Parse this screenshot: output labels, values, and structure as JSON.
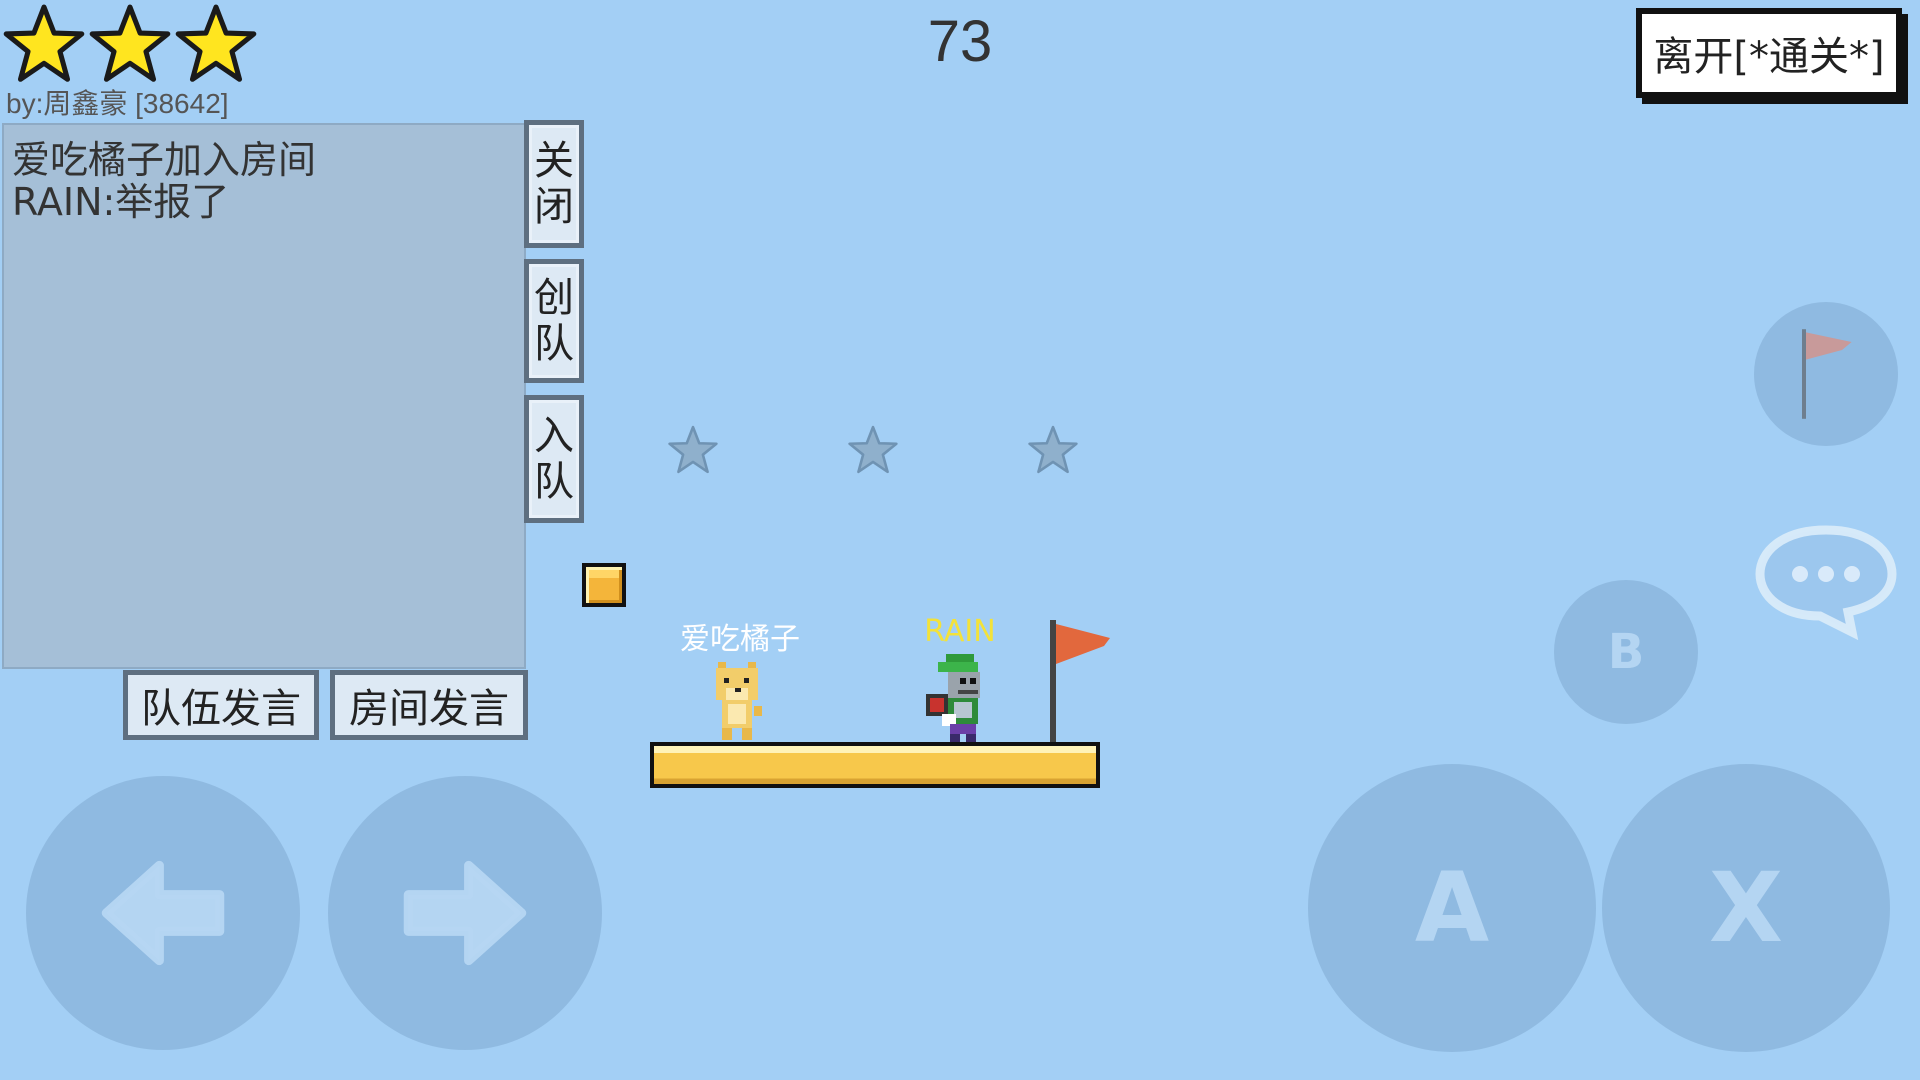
{
  "hud": {
    "stars_earned": 3,
    "stars_total": 3,
    "author": "by:周鑫豪 [38642]",
    "timer": "73",
    "leave_button": "离开[*通关*]"
  },
  "chat": {
    "messages": [
      "爱吃橘子加入房间",
      "RAIN:举报了"
    ],
    "side_buttons": {
      "close": [
        "关",
        "闭"
      ],
      "create_team": [
        "创",
        "队"
      ],
      "join_team": [
        "入",
        "队"
      ]
    },
    "team_say": "队伍发言",
    "room_say": "房间发言"
  },
  "level": {
    "collectible_stars": 3,
    "players": [
      {
        "name": "爱吃橘子",
        "color": "#ffffff"
      },
      {
        "name": "RAIN",
        "color": "#f3e23a"
      }
    ]
  },
  "controls": {
    "dpad_left": "left-arrow-icon",
    "dpad_right": "right-arrow-icon",
    "button_a": "A",
    "button_b": "B",
    "button_x": "X",
    "checkpoint": "flag-icon",
    "chat_toggle": "speech-bubble-icon"
  },
  "colors": {
    "sky": "#a3cff5",
    "star_gold": "#ffe51f",
    "star_dim": "#8fb0cc",
    "flag": "#e2683d",
    "platform": "#f7c84b"
  }
}
